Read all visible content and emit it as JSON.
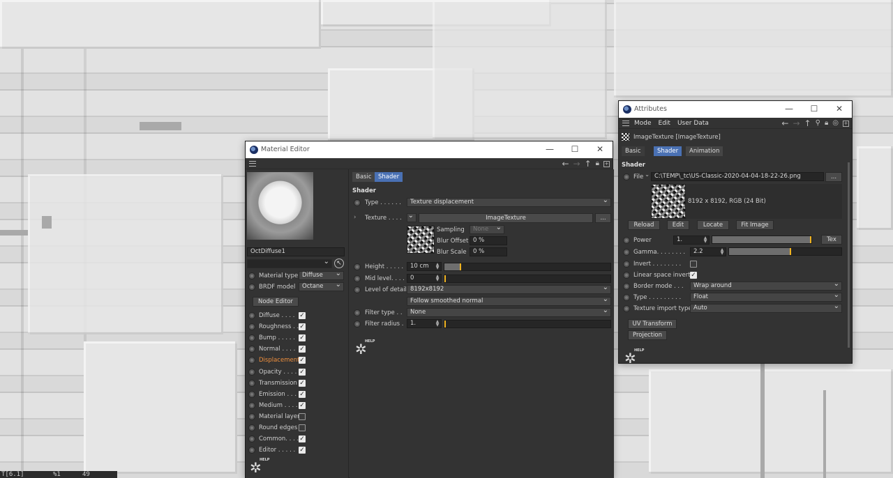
{
  "status_bar": {
    "left": "T[6.1]",
    "mid": "%1",
    "right": "49"
  },
  "material_editor": {
    "title": "Material Editor",
    "material_name": "OctDiffuse1",
    "material_type_label": "Material type",
    "material_type_value": "Diffuse",
    "brdf_label": "BRDF model",
    "brdf_value": "Octane",
    "node_editor": "Node Editor",
    "channels": [
      {
        "label": "Diffuse . . . .",
        "checked": true
      },
      {
        "label": "Roughness . .",
        "checked": true
      },
      {
        "label": "Bump . . . . .",
        "checked": true
      },
      {
        "label": "Normal . . . .",
        "checked": true
      },
      {
        "label": "Displacement",
        "checked": true,
        "highlight": true
      },
      {
        "label": "Opacity . . . .",
        "checked": true
      },
      {
        "label": "Transmission",
        "checked": true
      },
      {
        "label": "Emission . . .",
        "checked": true
      },
      {
        "label": "Medium . . . .",
        "checked": true
      },
      {
        "label": "Material layer",
        "checked": false
      },
      {
        "label": "Round edges",
        "checked": false
      },
      {
        "label": "Common. . . .",
        "checked": true
      },
      {
        "label": "Editor . . . . .",
        "checked": true
      }
    ],
    "tabs": [
      "Basic",
      "Shader"
    ],
    "section": "Shader",
    "type_label": "Type . . . . . .",
    "type_value": "Texture displacement",
    "texture_label": "Texture . . . .",
    "texture_value": "ImageTexture",
    "more_btn": "...",
    "sampling_label": "Sampling",
    "sampling_value": "None",
    "blur_offset_label": "Blur Offset",
    "blur_offset_value": "0 %",
    "blur_scale_label": "Blur Scale",
    "blur_scale_value": "0 %",
    "height_label": "Height . . . . .",
    "height_value": "10 cm",
    "height_fill": 0.1,
    "mid_label": "Mid level. . . .",
    "mid_value": "0",
    "lod_label": "Level of detail",
    "lod_value": "8192x8192",
    "smooth_value": "Follow smoothed normal",
    "filter_type_label": "Filter type . .",
    "filter_type_value": "None",
    "filter_radius_label": "Filter radius .",
    "filter_radius_value": "1.",
    "help": "HELP"
  },
  "attributes": {
    "title": "Attributes",
    "menus": [
      "Mode",
      "Edit",
      "User Data"
    ],
    "object_title": "ImageTexture [ImageTexture]",
    "tabs": [
      "Basic",
      "Shader",
      "Animation"
    ],
    "section": "Shader",
    "file_label": "File",
    "file_path": "C:\\TEMP\\_tc\\US-Classic-2020-04-04-18-22-26.png",
    "file_btn": "...",
    "image_info": "8192 x 8192, RGB (24 Bit)",
    "buttons": [
      "Reload",
      "Edit",
      "Locate",
      "Fit Image"
    ],
    "power_label": "Power",
    "power_value": "1.",
    "power_fill": 1.0,
    "tex_btn": "Tex",
    "gamma_label": "Gamma. . . . . . . .",
    "gamma_value": "2.2",
    "gamma_fill": 0.55,
    "invert_label": "Invert . . . . . . . .",
    "linear_label": "Linear space invert",
    "border_label": "Border mode . . .",
    "border_value": "Wrap around",
    "type_label": "Type . . . . . . . . .",
    "type_value": "Float",
    "import_label": "Texture import type",
    "import_value": "Auto",
    "uv_btn": "UV Transform",
    "proj_btn": "Projection",
    "help": "HELP"
  }
}
